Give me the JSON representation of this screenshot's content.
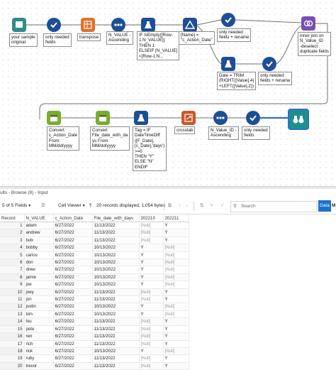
{
  "workflow": {
    "labels": {
      "input": "your sample\noriginal",
      "select1": "only needed\nfields",
      "transpose": "transpose",
      "sort1": "N_VALUE -\nAscending",
      "formula1": "IF IsEmpty([Row-\n1:N_VALUE])\nTHEN 1\nELSEIF [N_VALUE]\n<[Row-1:N...",
      "filter1": "[Name] =\n\"c_Action_Date\"",
      "select2": "only needed\nfields + rename",
      "join": "inner join on\nN_Value_ID\n-deselect\nduplicate fields",
      "formula2": "Date = TRIM\n(RIGHT([Value],4)\n+LEFT([Value],2))",
      "select3": "only needed\nfields + rename",
      "datetime1": "Convert\nc_Action_Date\nFrom:\nMM/dd/yyyy",
      "datetime2": "Convert\nFile_date_with_da\nys From:\nMM/dd/yyyy",
      "formula3": "Tag = IF\nDateTimeDiff\n([F_Date],\n[c_Date],'days')\n>=0\nTHEN \"Y\"\nELSE \"N\"\nENDIF",
      "crosstab": "crosstab",
      "sort2": "N_Value_ID -\nAscending",
      "select4": "only needed\nfields"
    },
    "colors": {
      "input": "#2e8b8b",
      "select": "#1d4f96",
      "transform": "#e0702a",
      "formula": "#1d4f96",
      "filter": "#1d4f96",
      "join": "#7a4fb4",
      "datetime": "#7cab2f",
      "crosstab": "#c9582a",
      "browse": "#1f8f8a"
    }
  },
  "results": {
    "title": "ults - Browse (8) - Input",
    "fields_selector": "5 of 5 Fields",
    "cell_viewer": "Cell Viewer",
    "records_info": "20 records displayed, 1,054 bytes",
    "search_placeholder": "Search",
    "data_tab": "Data",
    "meta_tab": "M"
  },
  "table": {
    "columns": [
      "Record",
      "N_VALUE",
      "c_Action_Date",
      "File_date_with_days",
      "202210",
      "202211"
    ],
    "rows": [
      [
        "1",
        "adam",
        "6/27/2022",
        "11/13/2022",
        "[Null]",
        "Y"
      ],
      [
        "2",
        "andrew",
        "6/27/2022",
        "11/13/2022",
        "[Null]",
        "Y"
      ],
      [
        "3",
        "bob",
        "6/27/2022",
        "11/13/2022",
        "[Null]",
        "Y"
      ],
      [
        "4",
        "bobby",
        "6/27/2022",
        "10/13/2022",
        "Y",
        "[Null]"
      ],
      [
        "5",
        "carlos",
        "6/27/2022",
        "10/13/2022",
        "Y",
        "[Null]"
      ],
      [
        "6",
        "don",
        "6/27/2022",
        "10/13/2022",
        "Y",
        "[Null]"
      ],
      [
        "7",
        "drew",
        "6/27/2022",
        "10/13/2022",
        "Y",
        "[Null]"
      ],
      [
        "8",
        "jamie",
        "6/27/2022",
        "10/13/2022",
        "Y",
        "[Null]"
      ],
      [
        "9",
        "joe",
        "6/27/2022",
        "10/13/2022",
        "Y",
        "[Null]"
      ],
      [
        "10",
        "joey",
        "6/27/2022",
        "11/13/2022",
        "[Null]",
        "Y"
      ],
      [
        "11",
        "jon",
        "6/27/2022",
        "11/13/2022",
        "[Null]",
        "Y"
      ],
      [
        "12",
        "justin",
        "6/27/2022",
        "10/13/2022",
        "Y",
        "[Null]"
      ],
      [
        "13",
        "kim",
        "6/27/2022",
        "10/13/2022",
        "Y",
        "[Null]"
      ],
      [
        "14",
        "lou",
        "6/27/2022",
        "11/13/2022",
        "[Null]",
        "Y"
      ],
      [
        "15",
        "pete",
        "6/27/2022",
        "11/13/2022",
        "[Null]",
        "Y"
      ],
      [
        "16",
        "ren",
        "6/27/2022",
        "11/13/2022",
        "[Null]",
        "Y"
      ],
      [
        "17",
        "rich",
        "6/27/2022",
        "11/13/2022",
        "[Null]",
        "Y"
      ],
      [
        "18",
        "rick",
        "6/27/2022",
        "10/13/2022",
        "Y",
        "[Null]"
      ],
      [
        "19",
        "ruby",
        "6/27/2022",
        "11/13/2022",
        "[Null]",
        "Y"
      ],
      [
        "20",
        "trevor",
        "6/27/2022",
        "11/13/2022",
        "[Null]",
        "Y"
      ]
    ]
  }
}
